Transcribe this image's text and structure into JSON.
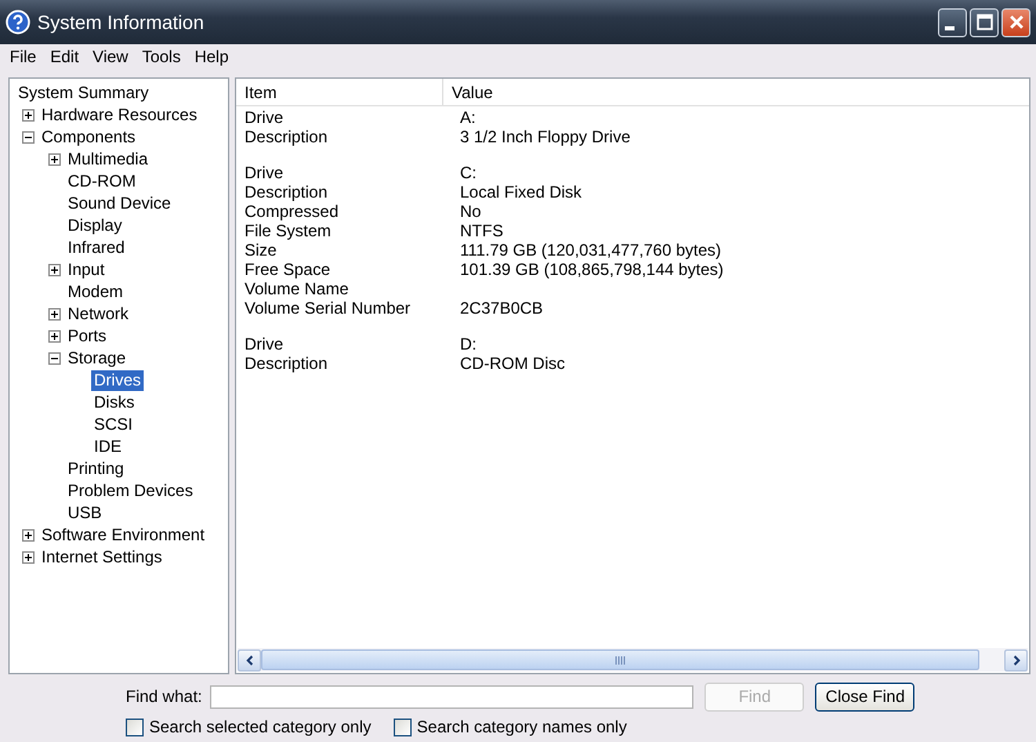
{
  "window": {
    "title": "System Information"
  },
  "menu": [
    "File",
    "Edit",
    "View",
    "Tools",
    "Help"
  ],
  "tree": [
    {
      "label": "System Summary",
      "selected": false
    },
    {
      "label": "Hardware Resources",
      "expanded": false,
      "selected": false
    },
    {
      "label": "Components",
      "expanded": true,
      "selected": false,
      "children": [
        {
          "label": "Multimedia",
          "expanded": false,
          "selected": false
        },
        {
          "label": "CD-ROM",
          "selected": false
        },
        {
          "label": "Sound Device",
          "selected": false
        },
        {
          "label": "Display",
          "selected": false
        },
        {
          "label": "Infrared",
          "selected": false
        },
        {
          "label": "Input",
          "expanded": false,
          "selected": false
        },
        {
          "label": "Modem",
          "selected": false
        },
        {
          "label": "Network",
          "expanded": false,
          "selected": false
        },
        {
          "label": "Ports",
          "expanded": false,
          "selected": false
        },
        {
          "label": "Storage",
          "expanded": true,
          "selected": false,
          "children": [
            {
              "label": "Drives",
              "selected": true
            },
            {
              "label": "Disks",
              "selected": false
            },
            {
              "label": "SCSI",
              "selected": false
            },
            {
              "label": "IDE",
              "selected": false
            }
          ]
        },
        {
          "label": "Printing",
          "selected": false
        },
        {
          "label": "Problem Devices",
          "selected": false
        },
        {
          "label": "USB",
          "selected": false
        }
      ]
    },
    {
      "label": "Software Environment",
      "expanded": false,
      "selected": false
    },
    {
      "label": "Internet Settings",
      "expanded": false,
      "selected": false
    }
  ],
  "table": {
    "columns": [
      "Item",
      "Value"
    ],
    "groups": [
      {
        "rows": [
          [
            "Drive",
            "A:"
          ],
          [
            "Description",
            "3 1/2 Inch Floppy Drive"
          ]
        ]
      },
      {
        "rows": [
          [
            "Drive",
            "C:"
          ],
          [
            "Description",
            "Local Fixed Disk"
          ],
          [
            "Compressed",
            "No"
          ],
          [
            "File System",
            "NTFS"
          ],
          [
            "Size",
            "111.79 GB (120,031,477,760 bytes)"
          ],
          [
            "Free Space",
            "101.39 GB (108,865,798,144 bytes)"
          ],
          [
            "Volume Name",
            ""
          ],
          [
            "Volume Serial Number",
            "2C37B0CB"
          ]
        ]
      },
      {
        "rows": [
          [
            "Drive",
            "D:"
          ],
          [
            "Description",
            "CD-ROM Disc"
          ]
        ]
      }
    ]
  },
  "find": {
    "label": "Find what:",
    "buttons": [
      {
        "label": "Find",
        "disabled": true
      },
      {
        "label": "Close Find",
        "disabled": false
      }
    ],
    "options": [
      {
        "label": "Search selected category only",
        "checked": false
      },
      {
        "label": "Search category names only",
        "checked": false
      }
    ]
  }
}
